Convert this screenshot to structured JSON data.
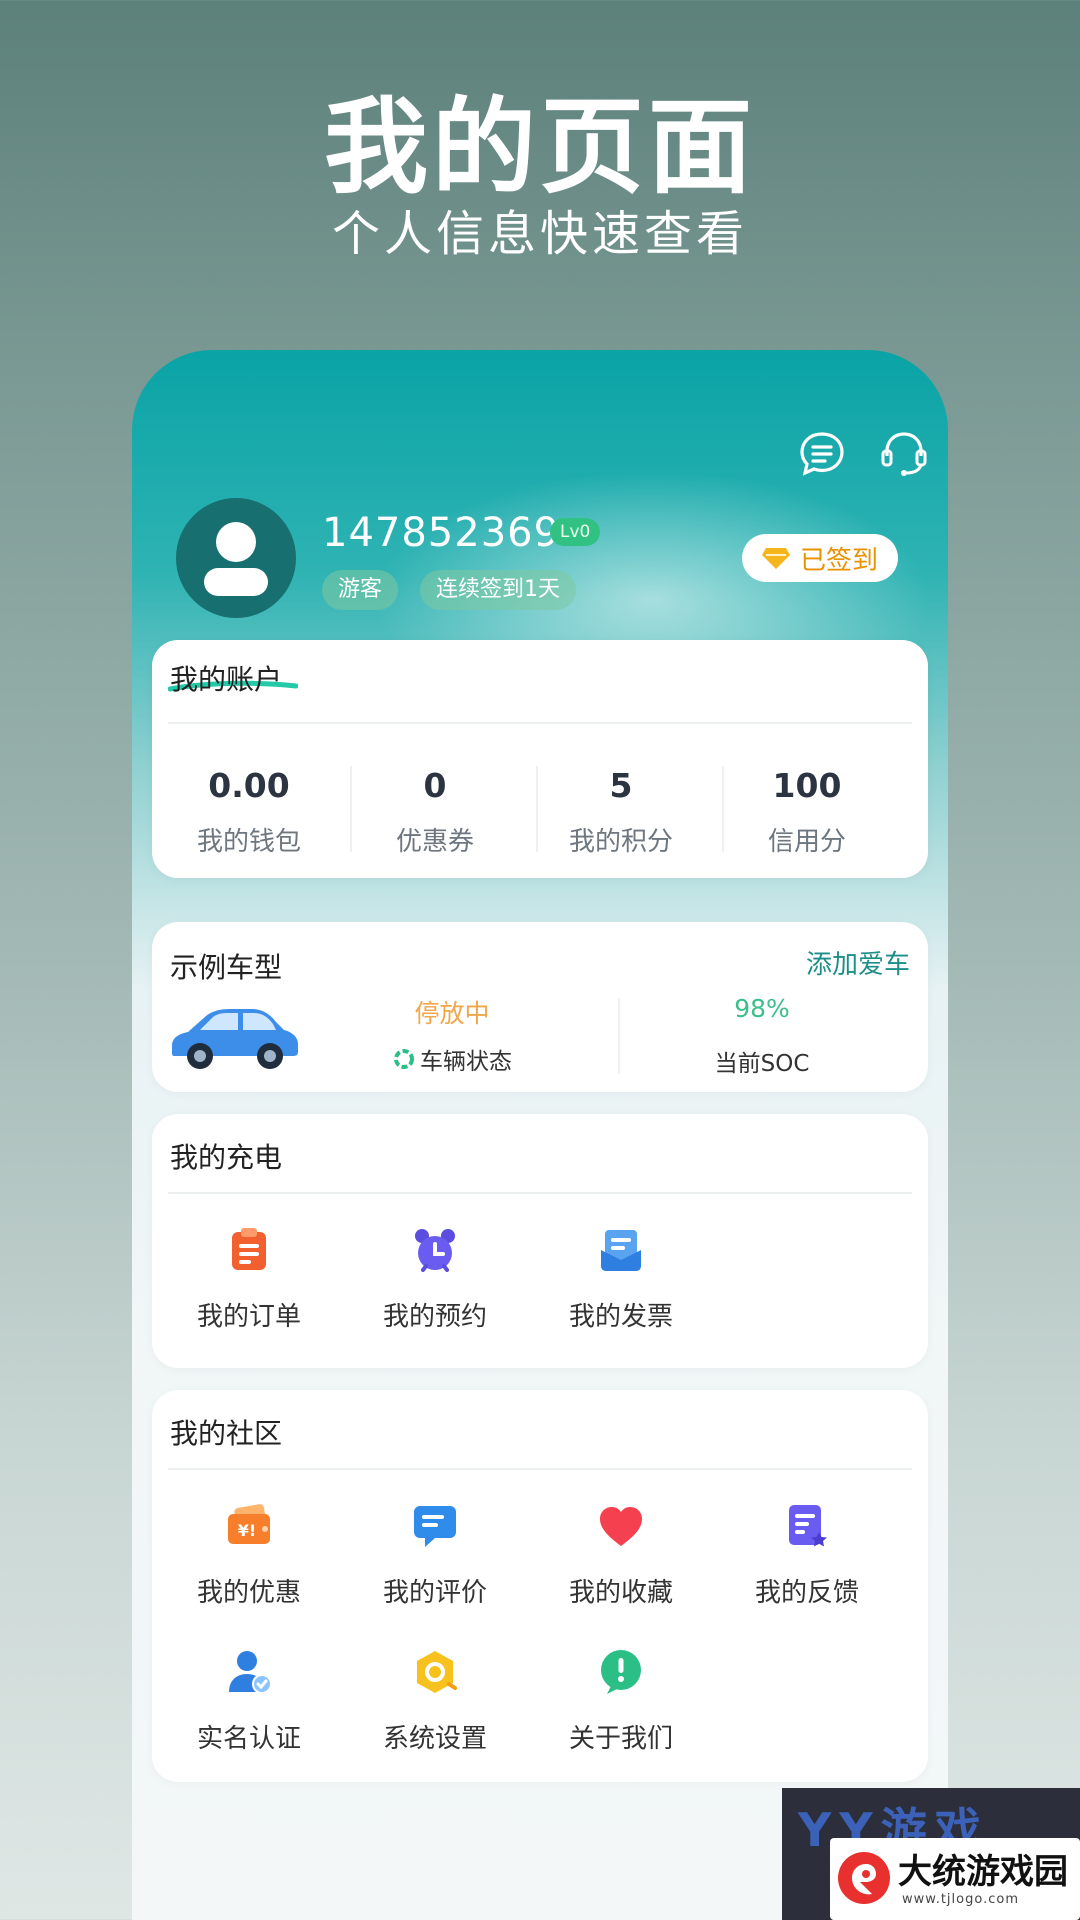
{
  "promo": {
    "title": "我的页面",
    "subtitle": "个人信息快速查看"
  },
  "header": {
    "username": "147852369",
    "level": "Lv0",
    "tags": [
      "游客",
      "连续签到1天"
    ],
    "signin_label": "已签到",
    "icons": [
      "message-icon",
      "customer-service-icon"
    ]
  },
  "account": {
    "title": "我的账户",
    "stats": [
      {
        "value": "0.00",
        "label": "我的钱包"
      },
      {
        "value": "0",
        "label": "优惠券"
      },
      {
        "value": "5",
        "label": "我的积分"
      },
      {
        "value": "100",
        "label": "信用分"
      }
    ]
  },
  "vehicle": {
    "title": "示例车型",
    "add_label": "添加爱车",
    "status_value": "停放中",
    "status_label": "车辆状态",
    "soc_value": "98%",
    "soc_label": "当前SOC"
  },
  "charging": {
    "title": "我的充电",
    "items": [
      {
        "label": "我的订单",
        "icon": "order-icon"
      },
      {
        "label": "我的预约",
        "icon": "alarm-clock-icon"
      },
      {
        "label": "我的发票",
        "icon": "invoice-icon"
      }
    ]
  },
  "community": {
    "title": "我的社区",
    "items": [
      {
        "label": "我的优惠",
        "icon": "coupon-icon"
      },
      {
        "label": "我的评价",
        "icon": "review-icon"
      },
      {
        "label": "我的收藏",
        "icon": "heart-icon"
      },
      {
        "label": "我的反馈",
        "icon": "feedback-icon"
      },
      {
        "label": "实名认证",
        "icon": "verified-user-icon"
      },
      {
        "label": "系统设置",
        "icon": "settings-icon"
      },
      {
        "label": "关于我们",
        "icon": "info-icon"
      }
    ]
  },
  "watermark": {
    "top_text": "YY游戏",
    "name": "大统游戏园",
    "url": "www.tjlogo.com"
  },
  "colors": {
    "accent": "#0aa3a6",
    "status_orange": "#f0a64a",
    "soc_green": "#3cbf8a",
    "link_teal": "#1d8f88"
  }
}
